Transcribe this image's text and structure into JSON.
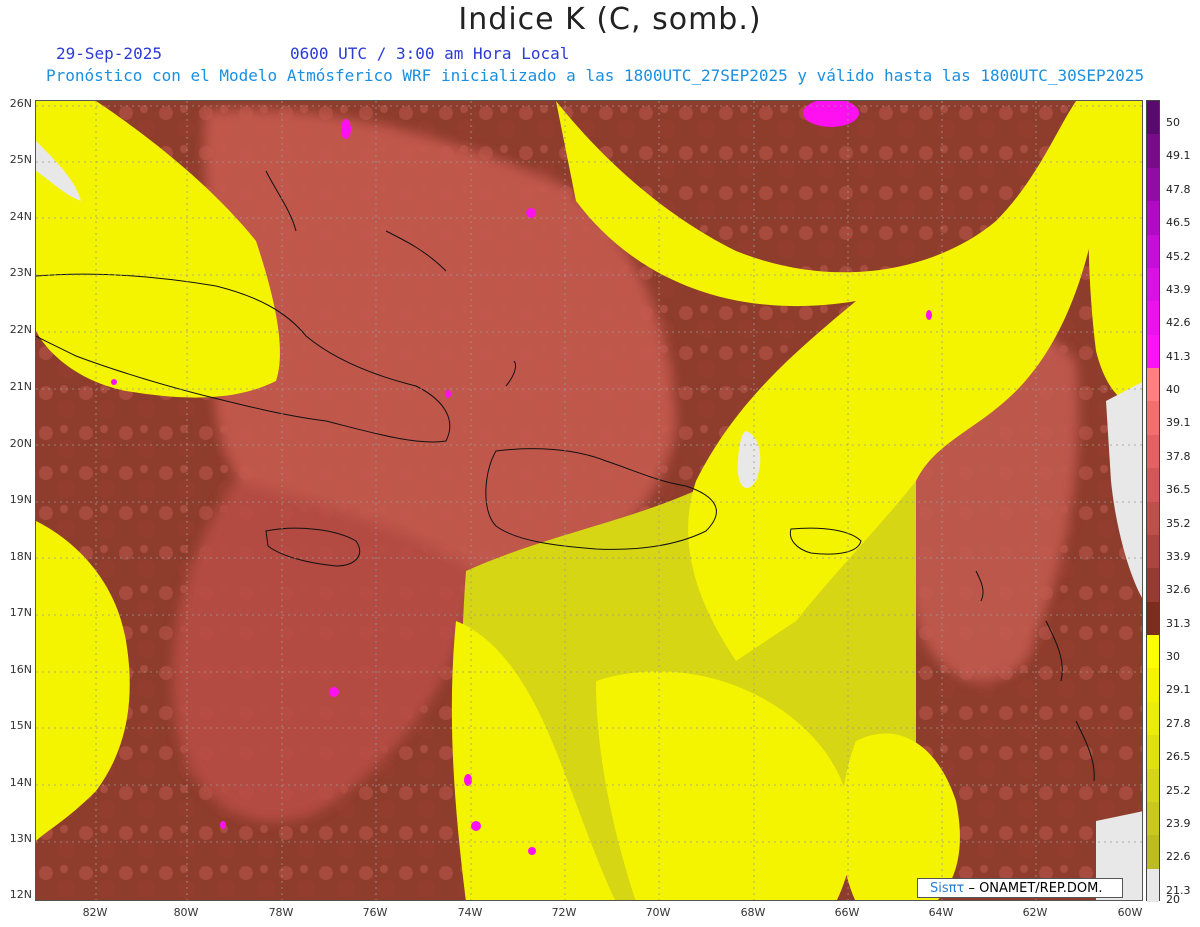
{
  "header": {
    "title": "Indice K (C, somb.)",
    "date": "29-Sep-2025",
    "time": "0600 UTC / 3:00 am Hora Local",
    "description": "Pronóstico con el Modelo Atmósferico WRF inicializado a las 1800UTC_27SEP2025 y válido hasta las  1800UTC_30SEP2025"
  },
  "axes": {
    "lat_labels": [
      "26N",
      "25N",
      "24N",
      "23N",
      "22N",
      "21N",
      "20N",
      "19N",
      "18N",
      "17N",
      "16N",
      "15N",
      "14N",
      "13N",
      "12N"
    ],
    "lon_labels": [
      "82W",
      "80W",
      "78W",
      "76W",
      "74W",
      "72W",
      "70W",
      "68W",
      "66W",
      "64W",
      "62W",
      "60W"
    ]
  },
  "colorbar": {
    "labels": [
      "50",
      "49.1",
      "47.8",
      "46.5",
      "45.2",
      "43.9",
      "42.6",
      "41.3",
      "40",
      "39.1",
      "37.8",
      "36.5",
      "35.2",
      "33.9",
      "32.6",
      "31.3",
      "30",
      "29.1",
      "27.8",
      "26.5",
      "25.2",
      "23.9",
      "22.6",
      "21.3",
      "20"
    ],
    "colors": [
      "#5a0a6e",
      "#7a0a8c",
      "#940aa8",
      "#ad0cc0",
      "#c40fd4",
      "#d812e0",
      "#ea14ea",
      "#fa14f4",
      "#ff8080",
      "#f07070",
      "#e06262",
      "#d05858",
      "#bf4f4a",
      "#ad4440",
      "#993a32",
      "#7d2c1e",
      "#ffff00",
      "#f4f400",
      "#ecec0a",
      "#e0e010",
      "#d4d418",
      "#c8c81e",
      "#bcbc20",
      "#e8e8e8"
    ],
    "palette": {
      "dark_brown": "#8b3a2a",
      "mid_brown": "#a64a3c",
      "salmon": "#d0625a",
      "yellow": "#f2f200",
      "olive_yellow": "#cfcf18",
      "magenta": "#ff10f0",
      "land_gray": "#e8e8e8"
    }
  },
  "credit": {
    "brand": "Sisπτ",
    "text": "–  ONAMET/REP.DOM."
  }
}
